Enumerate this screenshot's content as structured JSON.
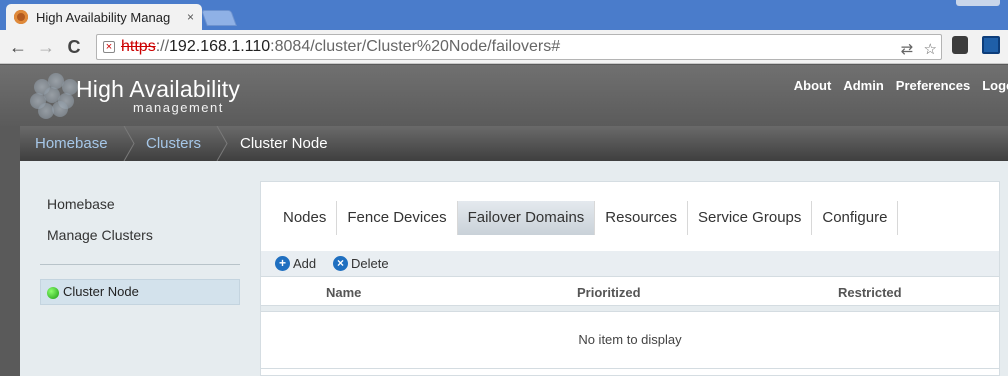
{
  "browser": {
    "tab_title": "High Availability Manag",
    "tab_close": "×",
    "back_icon": "←",
    "forward_icon": "→",
    "reload_icon": "C",
    "url_scheme": "https",
    "url_sep": "://",
    "url_host": "192.168.1.110",
    "url_rest": ":8084/cluster/Cluster%20Node/failovers#",
    "lock_mark": "×",
    "translate_icon": "⇄",
    "star_icon": "☆"
  },
  "app": {
    "brand_title": "High Availability",
    "brand_subtitle": "management",
    "nav": [
      "About",
      "Admin",
      "Preferences",
      "Logo"
    ]
  },
  "breadcrumb": [
    "Homebase",
    "Clusters",
    "Cluster Node"
  ],
  "sidebar": {
    "links": [
      "Homebase",
      "Manage Clusters"
    ],
    "cluster_item": "Cluster Node",
    "status_color": "#1fb21a"
  },
  "tabs": [
    "Nodes",
    "Fence Devices",
    "Failover Domains",
    "Resources",
    "Service Groups",
    "Configure"
  ],
  "active_tab": "Failover Domains",
  "actions": {
    "add": "Add",
    "add_icon": "+",
    "delete": "Delete",
    "delete_icon": "×"
  },
  "table": {
    "columns": [
      "Name",
      "Prioritized",
      "Restricted"
    ],
    "empty_message": "No item to display"
  },
  "colors": {
    "breadcrumb_link": "#a6c7e8",
    "accent": "#1f6fc0"
  }
}
